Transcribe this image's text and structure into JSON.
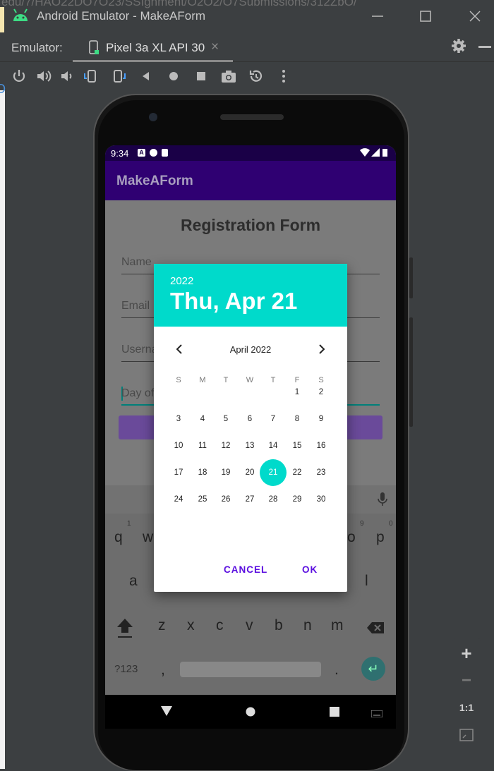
{
  "window": {
    "background_url_fragment": "edu/7/HAO22DO7O23/SSIgnment/O2O2/O7Submissions/312ZbO/",
    "title": "Android Emulator - MakeAForm"
  },
  "tabbar": {
    "emulator_label": "Emulator:",
    "device_tab_label": "Pixel 3a XL API 30",
    "close_glyph": "×"
  },
  "toolbar": {
    "icons": [
      "power-icon",
      "volume-up-icon",
      "volume-down-icon",
      "rotate-left-icon",
      "rotate-right-icon",
      "back-icon",
      "home-icon",
      "overview-icon",
      "screenshot-icon",
      "snapshot-icon",
      "more-icon"
    ]
  },
  "left_edge_text": "O",
  "status": {
    "time": "9:34",
    "icon_labels": [
      "A"
    ]
  },
  "app": {
    "title": "MakeAForm",
    "form_title": "Registration Form",
    "fields": [
      {
        "placeholder": "Name"
      },
      {
        "placeholder": "Email"
      },
      {
        "placeholder": "Userna"
      },
      {
        "placeholder": "Day of"
      }
    ]
  },
  "keyboard": {
    "row1": [
      "q",
      "w",
      "o",
      "p"
    ],
    "row1_numbers": [
      "1",
      "9",
      "0"
    ],
    "row2": [
      "a",
      "l"
    ],
    "row3": [
      "z",
      "x",
      "c",
      "v",
      "b",
      "n",
      "m"
    ],
    "bottom_left": "?123",
    "comma": ",",
    "period": "."
  },
  "date_picker": {
    "year": "2022",
    "selected_date_label": "Thu, Apr 21",
    "month_label": "April 2022",
    "weekdays": [
      "S",
      "M",
      "T",
      "W",
      "T",
      "F",
      "S"
    ],
    "selected_day": 21,
    "first_weekday_index": 5,
    "days_in_month": 30,
    "cancel_label": "CANCEL",
    "ok_label": "OK",
    "accent_color": "#00dacb",
    "button_color": "#5b0fe0"
  },
  "zoom_panel": {
    "plus": "+",
    "minus": "−",
    "one_to_one": "1:1"
  }
}
